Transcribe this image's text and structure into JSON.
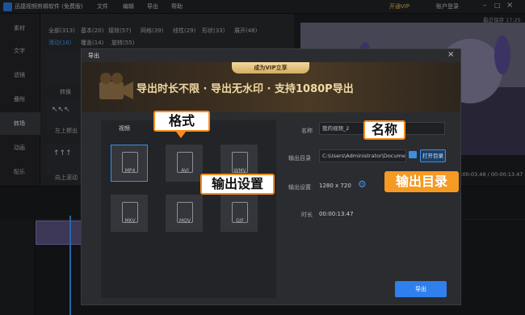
{
  "titlebar": {
    "app_name": "迅捷视频剪辑软件 (免费版)",
    "menu": [
      "文件",
      "编辑",
      "导出",
      "帮助"
    ],
    "vip": "开通VIP",
    "account": "账户登录",
    "recent_save": "最近保存 17:25"
  },
  "leftnav": {
    "items": [
      "素材",
      "文字",
      "滤镜",
      "叠附",
      "转场",
      "动画",
      "配乐"
    ],
    "active": "转场"
  },
  "library": {
    "categories_row1": [
      "全部(313)",
      "基本(20)",
      "接效(57)",
      "网格(39)",
      "线性(29)",
      "形状(33)",
      "展开(48)"
    ],
    "categories_row2": [
      "滑动(18)",
      "覆盖(14)",
      "旋转(55)"
    ],
    "thumbs": [
      "转换",
      "左上擦出",
      "向上滚动"
    ]
  },
  "preview": {
    "time": "00:00:03.49 / 00:00:13.47"
  },
  "dialog": {
    "title": "导出",
    "vip_tab": "成为VIP立享",
    "banner_text": "导出时长不限 · 导出无水印 · 支持1080P导出",
    "format_tab": "视频",
    "formats": [
      "MP4",
      "AVI",
      "WMV",
      "MKV",
      "MOV",
      "GIF"
    ],
    "selected_format": "MP4",
    "name_label": "名称",
    "name_value": "我的视频_2",
    "dir_label": "输出目录",
    "dir_value": "C:\\Users\\Administrator\\Documen",
    "open_dir": "打开目录",
    "settings_label": "输出设置",
    "settings_value": "1280 x 720",
    "duration_label": "时长",
    "duration_value": "00:00:13.47",
    "export_button": "导出"
  },
  "callouts": {
    "format": "格式",
    "name": "名称",
    "output_dir": "输出目录",
    "output_settings": "输出设置"
  },
  "colors": {
    "accent": "#2f80ed",
    "callout_border": "#ff8c1a",
    "callout_fill": "#f59a23"
  }
}
